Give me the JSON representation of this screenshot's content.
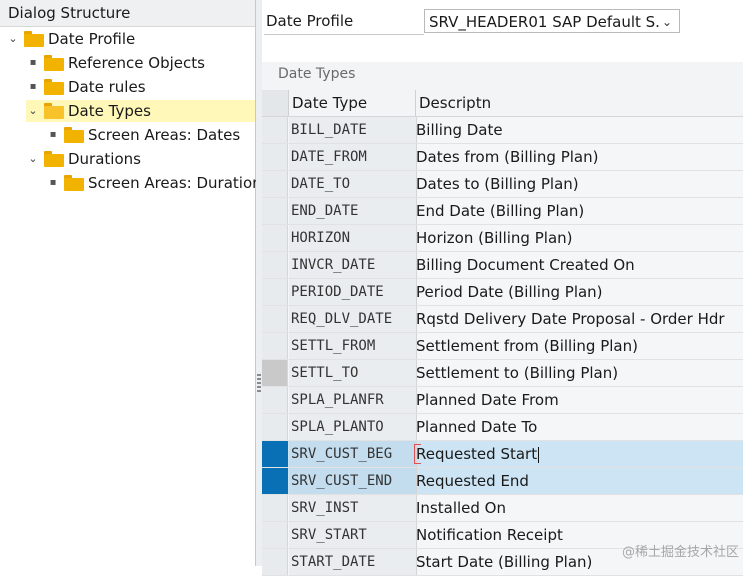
{
  "left_panel": {
    "title": "Dialog Structure",
    "tree": [
      {
        "label": "Date Profile",
        "expanded": true,
        "level": 0,
        "icon": "folder-icon"
      },
      {
        "label": "Reference Objects",
        "level": 1,
        "icon": "folder-icon"
      },
      {
        "label": "Date rules",
        "level": 1,
        "icon": "folder-icon"
      },
      {
        "label": "Date Types",
        "level": 1,
        "expanded": true,
        "selected": true,
        "icon": "open-folder-icon"
      },
      {
        "label": "Screen Areas: Dates",
        "level": 2,
        "icon": "folder-icon"
      },
      {
        "label": "Durations",
        "level": 1,
        "expanded": true,
        "icon": "folder-icon"
      },
      {
        "label": "Screen Areas: Duration",
        "level": 2,
        "icon": "folder-icon"
      }
    ]
  },
  "profile": {
    "label": "Date Profile",
    "value": "SRV_HEADER01 SAP Default S...",
    "chevron_icon": "chevron-down-icon"
  },
  "table": {
    "title": "Date Types",
    "columns": [
      "Date Type",
      "Descriptn"
    ],
    "rows": [
      {
        "code": "BILL_DATE",
        "desc": "Billing Date"
      },
      {
        "code": "DATE_FROM",
        "desc": "Dates from (Billing Plan)"
      },
      {
        "code": "DATE_TO",
        "desc": "Dates to (Billing Plan)"
      },
      {
        "code": "END_DATE",
        "desc": "End Date (Billing Plan)"
      },
      {
        "code": "HORIZON",
        "desc": "Horizon (Billing Plan)"
      },
      {
        "code": "INVCR_DATE",
        "desc": "Billing Document Created On"
      },
      {
        "code": "PERIOD_DATE",
        "desc": "Period Date (Billing Plan)"
      },
      {
        "code": "REQ_DLV_DATE",
        "desc": "Rqstd Delivery Date Proposal - Order Hdr"
      },
      {
        "code": "SETTL_FROM",
        "desc": "Settlement from (Billing Plan)"
      },
      {
        "code": "SETTL_TO",
        "desc": "Settlement to (Billing Plan)"
      },
      {
        "code": "SPLA_PLANFR",
        "desc": "Planned Date From"
      },
      {
        "code": "SPLA_PLANTO",
        "desc": "Planned Date To"
      },
      {
        "code": "SRV_CUST_BEG",
        "desc": "Requested Start"
      },
      {
        "code": "SRV_CUST_END",
        "desc": "Requested End"
      },
      {
        "code": "SRV_INST",
        "desc": "Installed On"
      },
      {
        "code": "SRV_START",
        "desc": "Notification Receipt"
      },
      {
        "code": "START_DATE",
        "desc": "Start Date (Billing Plan)"
      }
    ]
  },
  "watermark": "@稀土掘金技术社区",
  "colors": {
    "selection_blue": "#0a70b5",
    "selected_row": "#cce4f3",
    "tree_highlight": "#fff8b8",
    "folder": "#f2b300"
  }
}
